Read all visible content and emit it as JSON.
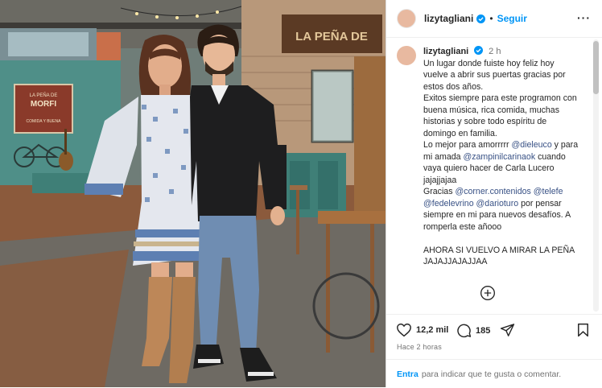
{
  "post": {
    "username": "lizytagliani",
    "follow_label": "Seguir",
    "more_label": "···",
    "separator": "•"
  },
  "caption": {
    "username": "lizytagliani",
    "time": "2 h",
    "lines": [
      [
        {
          "t": "Un lugar donde fuiste hoy feliz hoy vuelve a abrir sus puertas gracias por estos dos años."
        }
      ],
      [
        {
          "t": "Exitos siempre para este programon con buena música, rica comida, muchas historias y sobre todo espíritu de domingo en familia."
        }
      ],
      [
        {
          "t": "Lo mejor para amorrrrr "
        },
        {
          "m": "@dieleuco"
        },
        {
          "t": " y para mi amada "
        },
        {
          "m": "@zampinilcarinaok"
        },
        {
          "t": " cuando vaya quiero hacer de Carla Lucero jajajjajaa"
        }
      ],
      [
        {
          "t": "Gracias "
        },
        {
          "m": "@corner.contenidos"
        },
        {
          "t": " "
        },
        {
          "m": "@telefe"
        },
        {
          "t": " "
        },
        {
          "m": "@fedelevrino"
        },
        {
          "t": " "
        },
        {
          "m": "@darioturo"
        },
        {
          "t": " por pensar siempre en mi para nuevos desafíos. A romperla este añooo"
        }
      ],
      [
        {
          "t": " "
        }
      ],
      [
        {
          "t": "AHORA SI VUELVO A MIRAR LA PEÑA JAJAJJAJAJJAA"
        }
      ]
    ]
  },
  "actions": {
    "likes": "12,2 mil",
    "comments": "185",
    "time_ago": "Hace 2 horas"
  },
  "footer": {
    "login": "Entra",
    "text": "para indicar que te gusta o comentar."
  },
  "photo": {
    "sign_top": "LA PEÑA DE",
    "sign_main": "MORFI",
    "wall_sign": "LA PEÑA DE",
    "sign_sub": "COMIDA Y BUENA"
  }
}
